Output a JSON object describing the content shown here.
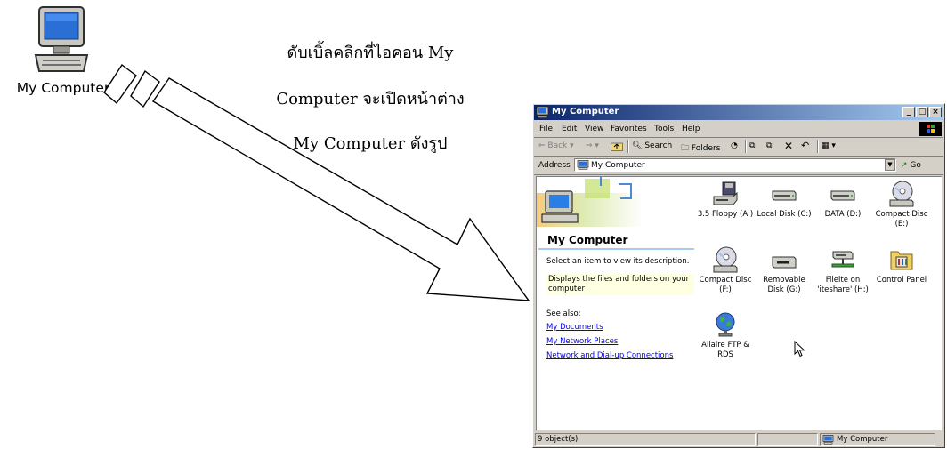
{
  "desktop": {
    "icon_label": "My Computer",
    "caption_lines": [
      "ดับเบิ้ลคลิกที่ไอคอน My",
      "Computer จะเปิดหน้าต่าง",
      "My Computer ดังรูป"
    ]
  },
  "window": {
    "title": "My Computer",
    "menu": [
      "File",
      "Edit",
      "View",
      "Favorites",
      "Tools",
      "Help"
    ],
    "toolbar": {
      "back": "Back",
      "search": "Search",
      "folders": "Folders"
    },
    "address": {
      "label": "Address",
      "value": "My Computer",
      "go": "Go"
    },
    "left_pane": {
      "title": "My Computer",
      "prompt": "Select an item to view its description.",
      "description": "Displays the files and folders on your computer",
      "see_also": "See also:",
      "links": [
        "My Documents",
        "My Network Places",
        "Network and Dial-up Connections"
      ]
    },
    "items": [
      {
        "label": "3.5 Floppy (A:)",
        "icon": "floppy-drive-icon"
      },
      {
        "label": "Local Disk (C:)",
        "icon": "hard-disk-icon"
      },
      {
        "label": "DATA (D:)",
        "icon": "hard-disk-icon"
      },
      {
        "label": "Compact Disc (E:)",
        "icon": "cd-drive-icon"
      },
      {
        "label": "Compact Disc (F:)",
        "icon": "cd-drive-icon"
      },
      {
        "label": "Removable Disk (G:)",
        "icon": "removable-disk-icon"
      },
      {
        "label": "Fileite on 'iteshare' (H:)",
        "icon": "network-drive-icon"
      },
      {
        "label": "Control Panel",
        "icon": "control-panel-icon"
      },
      {
        "label": "Allaire FTP & RDS",
        "icon": "globe-icon"
      }
    ],
    "status": {
      "count": "9 object(s)",
      "zone": "My Computer"
    }
  },
  "colors": {
    "titlebar_start": "#0a246a",
    "titlebar_end": "#a6caf0",
    "link": "#0000ee",
    "window_face": "#d4d0c8"
  }
}
